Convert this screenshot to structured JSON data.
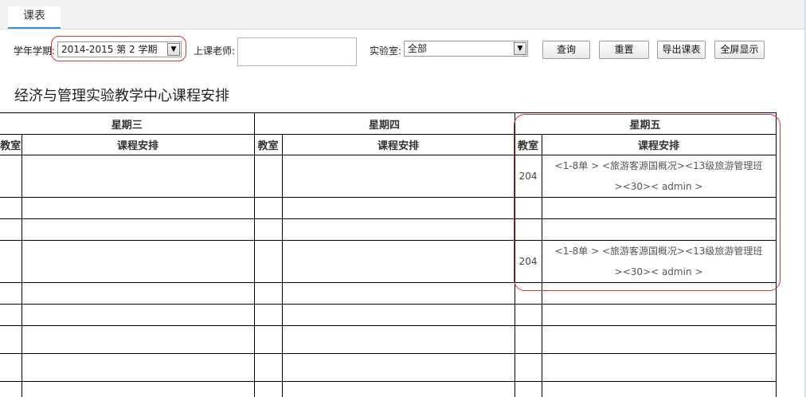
{
  "tab": {
    "label": "课表"
  },
  "filters": {
    "term_label": "学年学期:",
    "term_value": "2014-2015 第  2 学期",
    "teacher_label": "上课老师:",
    "teacher_value": "",
    "lab_label": "实验室:",
    "lab_value": "全部"
  },
  "buttons": {
    "query": "查询",
    "reset": "重置",
    "export": "导出课表",
    "fullscreen": "全屏显示"
  },
  "page_title": "经济与管理实验教学中心课程安排",
  "table": {
    "days": [
      "星期三",
      "星期四",
      "星期五"
    ],
    "col_room": "教室",
    "col_schedule": "课程安排",
    "entries": {
      "fri_row1": {
        "room": "204",
        "line1": "<1-8单 > <旅游客源国概况><13级旅游管理班",
        "line2": "><30>< admin >"
      },
      "fri_row4": {
        "room": "204",
        "line1": "<1-8单 > <旅游客源国概况><13级旅游管理班",
        "line2": "><30>< admin >"
      }
    }
  }
}
